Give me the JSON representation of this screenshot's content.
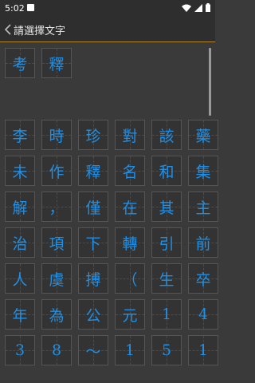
{
  "status_bar": {
    "time": "5:02"
  },
  "app_bar": {
    "title": "請選擇文字"
  },
  "selected_chars": [
    "考",
    "釋"
  ],
  "char_grid": [
    "李",
    "時",
    "珍",
    "對",
    "該",
    "藥",
    "未",
    "作",
    "釋",
    "名",
    "和",
    "集",
    "解",
    "，",
    "僅",
    "在",
    "其",
    "主",
    "治",
    "項",
    "下",
    "轉",
    "引",
    "前",
    "人",
    "虞",
    "搏",
    "（",
    "生",
    "卒",
    "年",
    "為",
    "公",
    "元",
    "1",
    "4",
    "3",
    "8",
    "～",
    "1",
    "5",
    "1"
  ],
  "colors": {
    "accent": "#b8862a",
    "char_text": "#1e90e8",
    "background": "#3a3a3a"
  }
}
